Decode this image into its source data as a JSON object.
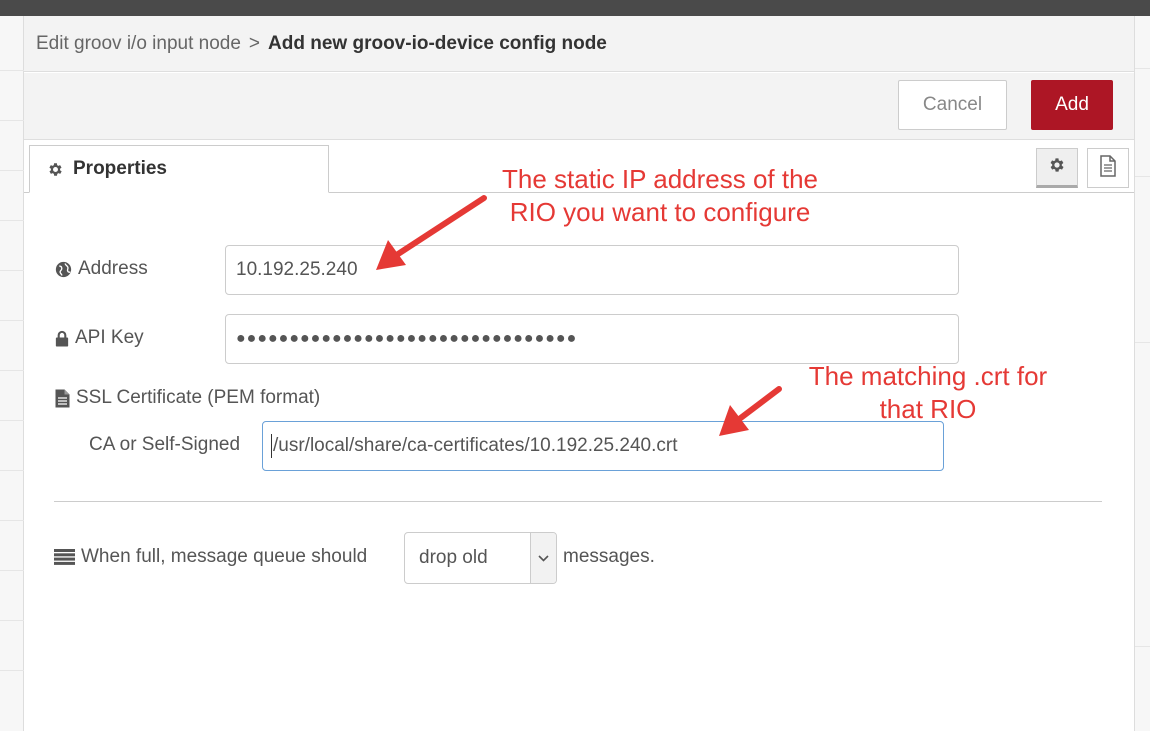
{
  "breadcrumb": {
    "parent": "Edit groov i/o input node",
    "separator": ">",
    "current": "Add new groov-io-device config node"
  },
  "buttons": {
    "cancel": "Cancel",
    "add": "Add"
  },
  "tabs": {
    "properties": "Properties"
  },
  "form": {
    "address_label": "Address",
    "address_value": "10.192.25.240",
    "api_key_label": "API Key",
    "api_key_value": "●●●●●●●●●●●●●●●●●●●●●●●●●●●●●●●●",
    "ssl_label": "SSL Certificate (PEM format)",
    "ca_label": "CA or Self-Signed",
    "ca_value": "/usr/local/share/ca-certificates/10.192.25.240.crt",
    "queue_prefix": "When full, message queue should",
    "queue_selected": "drop old",
    "queue_suffix": "messages."
  },
  "annotations": {
    "address_note_line1": "The static IP address of the",
    "address_note_line2": "RIO you want to configure",
    "cert_note_line1": "The matching .crt for",
    "cert_note_line2": "that RIO"
  },
  "colors": {
    "accent": "#ad1625",
    "annotation": "#e53935"
  }
}
